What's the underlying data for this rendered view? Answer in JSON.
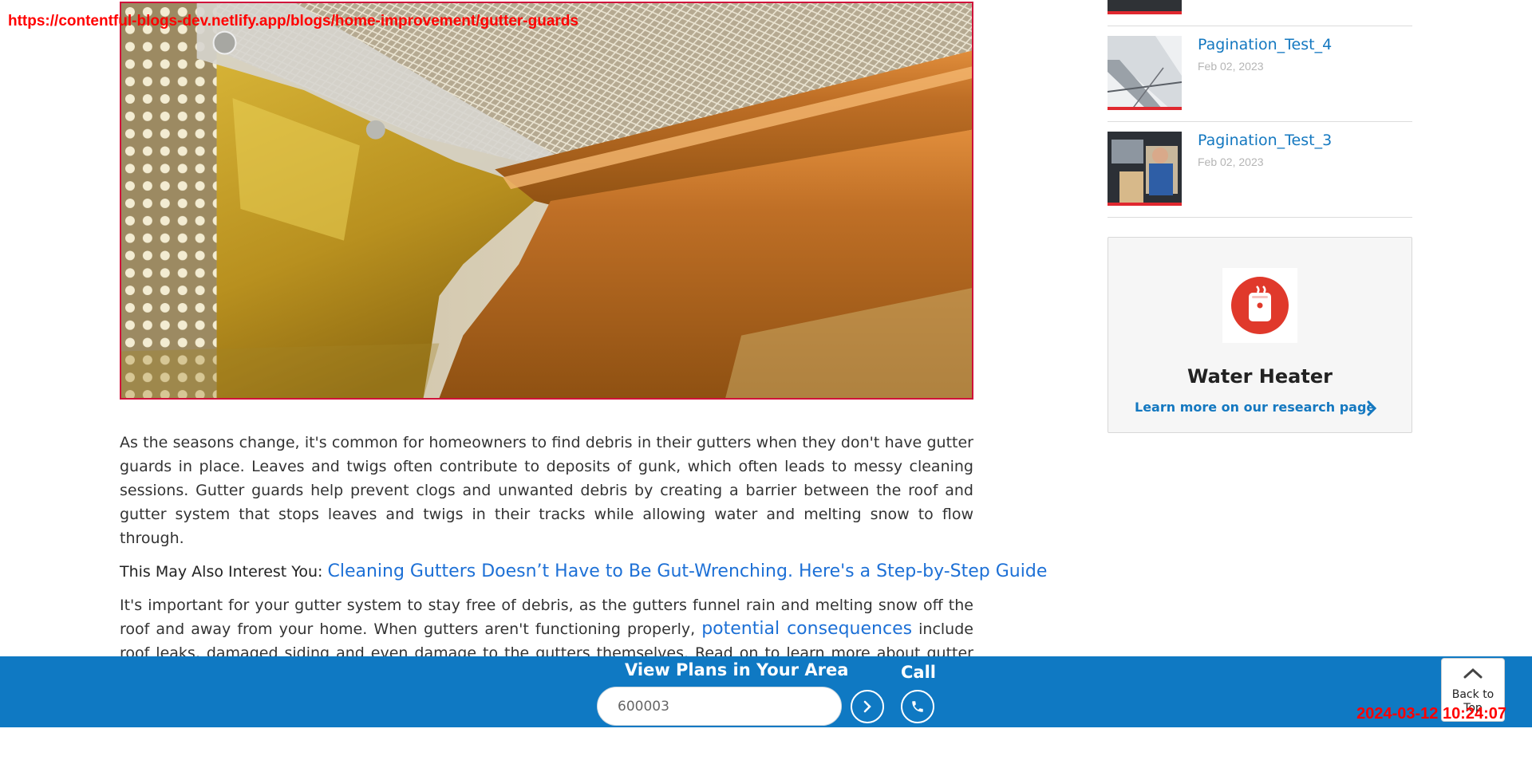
{
  "overlay": {
    "url": "https://contentful-blogs-dev.netlify.app/blogs/home-improvement/gutter-guards",
    "timestamp": "2024-03-12 10:24:07"
  },
  "article": {
    "paragraph1": "As the seasons change, it's common for homeowners to find debris in their gutters when they don't have gutter guards in place. Leaves and twigs often contribute to deposits of gunk, which often leads to messy cleaning sessions. Gutter guards help prevent clogs and unwanted debris by creating a barrier between the roof and gutter system that stops leaves and twigs in their tracks while allowing water and melting snow to flow through.",
    "interest_label": "This May Also Interest You:",
    "interest_link": "Cleaning Gutters Doesn’t Have to Be Gut-Wrenching. Here's a Step-by-Step Guide",
    "paragraph2_before": "It's important for your gutter system to stay free of debris, as the gutters funnel rain and melting snow off the roof and away from your home. When gutters aren't functioning properly,",
    "paragraph2_link": "potential consequences",
    "paragraph2_after": "include roof leaks, damaged siding and even damage to the gutters themselves. Read on to learn more about gutter guards and how they can protect your home."
  },
  "sidebar": {
    "recent_posts": [
      {
        "title": "Pagination_Test_4",
        "date": "Feb 02, 2023"
      },
      {
        "title": "Pagination_Test_3",
        "date": "Feb 02, 2023"
      }
    ],
    "research_card": {
      "name": "Water Heater",
      "link": "Learn more on our research page",
      "icon": "water-heater-icon",
      "icon_color": "#e0392b"
    }
  },
  "bottom_bar": {
    "title": "View Plans in Your Area",
    "zip_value": "600003",
    "call_label": "Call",
    "back_to_top": "Back to Top",
    "bar_color": "#0f79c3"
  }
}
